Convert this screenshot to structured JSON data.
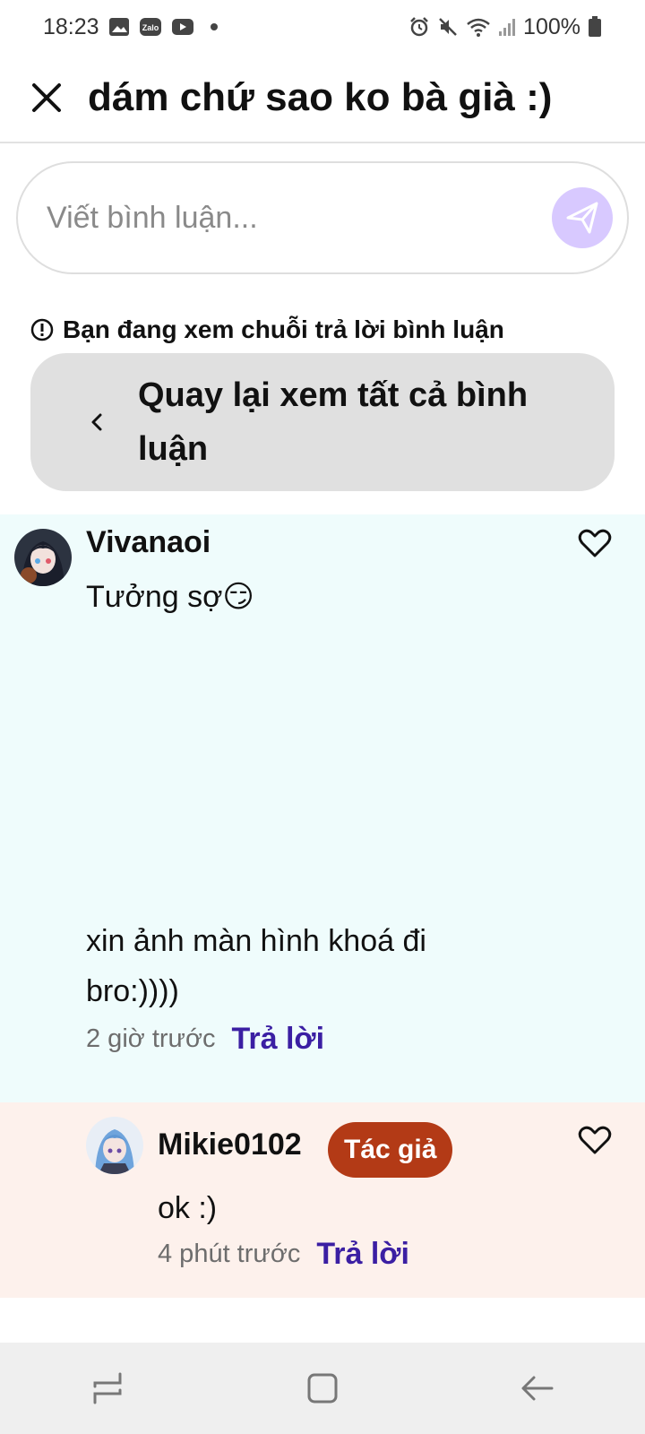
{
  "status_bar": {
    "time": "18:23",
    "battery": "100%",
    "left_icons": [
      "gallery-icon",
      "zalo-icon",
      "youtube-icon",
      "dot-icon"
    ],
    "right_icons": [
      "alarm-icon",
      "mute-icon",
      "wifi-icon",
      "signal-icon",
      "battery-icon"
    ]
  },
  "header": {
    "title": "dám chứ sao ko bà già :)"
  },
  "composer": {
    "placeholder": "Viết bình luận..."
  },
  "thread": {
    "notice": "Bạn đang xem chuỗi trả lời bình luận",
    "back_label": "Quay lại xem tất cả bình luận"
  },
  "comments": [
    {
      "username": "Vivanaoi",
      "text_line1": "Tưởng sợ😏",
      "text_line2": "xin ảnh màn hình khoá đi bro:))))",
      "time": "2 giờ trước",
      "reply_label": "Trả lời"
    },
    {
      "username": "Mikie0102",
      "badge": "Tác giả",
      "text": "ok :)",
      "time": "4 phút trước",
      "reply_label": "Trả lời"
    }
  ],
  "colors": {
    "main_comment_bg": "#effcfc",
    "reply_bg": "#fdf1ec",
    "accent": "#3b1fa3",
    "badge": "#b33a16",
    "send_button": "#d8c9ff"
  }
}
